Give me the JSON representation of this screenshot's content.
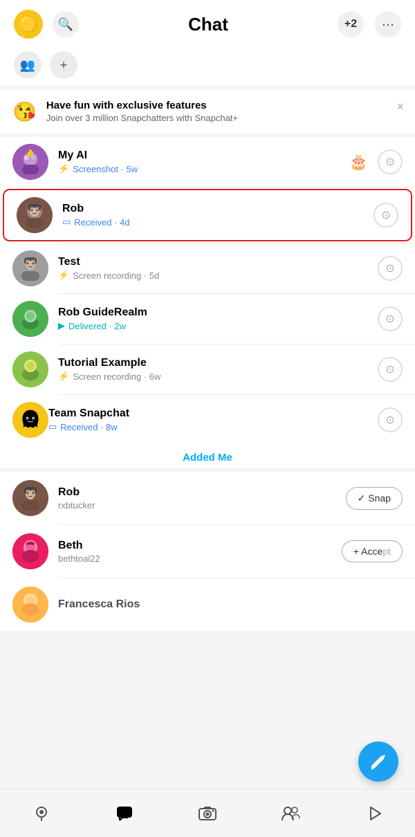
{
  "header": {
    "title": "Chat",
    "add_friend_label": "+2",
    "more_label": "···"
  },
  "promo": {
    "emoji": "😘",
    "title": "Have fun with exclusive features",
    "subtitle": "Join over 3 million Snapchatters with Snapchat+",
    "close": "×"
  },
  "chats": [
    {
      "id": "my-ai",
      "name": "My AI",
      "sub": "Screenshot · 5w",
      "sub_icon": "⚡",
      "sub_color": "blue",
      "avatar_emoji": "🤖",
      "avatar_bg": "#9b59b6",
      "highlighted": false
    },
    {
      "id": "rob",
      "name": "Rob",
      "sub": "Received · 4d",
      "sub_icon": "□",
      "sub_color": "blue",
      "avatar_emoji": "🧑",
      "avatar_bg": "#795548",
      "highlighted": true
    },
    {
      "id": "test",
      "name": "Test",
      "sub": "Screen recording · 5d",
      "sub_icon": "⚡",
      "sub_color": "default",
      "avatar_emoji": "🧑",
      "avatar_bg": "#9e9e9e",
      "highlighted": false
    },
    {
      "id": "rob-guiderealm",
      "name": "Rob GuideRealm",
      "sub": "Delivered · 2w",
      "sub_icon": "▶",
      "sub_color": "teal",
      "avatar_emoji": "👤",
      "avatar_bg": "#4caf50",
      "highlighted": false
    },
    {
      "id": "tutorial-example",
      "name": "Tutorial Example",
      "sub": "Screen recording · 6w",
      "sub_icon": "⚡",
      "sub_color": "default",
      "avatar_emoji": "👤",
      "avatar_bg": "#8bc34a",
      "highlighted": false
    },
    {
      "id": "team-snapchat",
      "name": "Team Snapchat",
      "sub": "Received · 8w",
      "sub_icon": "□",
      "sub_color": "blue",
      "avatar_emoji": "👻",
      "avatar_bg": "#f5c518",
      "highlighted": false
    }
  ],
  "added_me_label": "Added Me",
  "added_me": [
    {
      "id": "rob-added",
      "name": "Rob",
      "username": "rxbtucker",
      "action": "✓ Snap",
      "action_type": "snap"
    },
    {
      "id": "beth-added",
      "name": "Beth",
      "username": "bethtoal22",
      "action": "+ Acce",
      "action_type": "accept"
    },
    {
      "id": "francesca-added",
      "name": "Francesca Rios",
      "username": "",
      "action": "",
      "action_type": ""
    }
  ],
  "nav": {
    "items": [
      {
        "id": "map",
        "icon": "◎",
        "active": false
      },
      {
        "id": "chat",
        "icon": "💬",
        "active": true
      },
      {
        "id": "camera",
        "icon": "⊙",
        "active": false
      },
      {
        "id": "friends",
        "icon": "👥",
        "active": false
      },
      {
        "id": "discover",
        "icon": "▷",
        "active": false
      }
    ]
  },
  "fab_icon": "✏️"
}
